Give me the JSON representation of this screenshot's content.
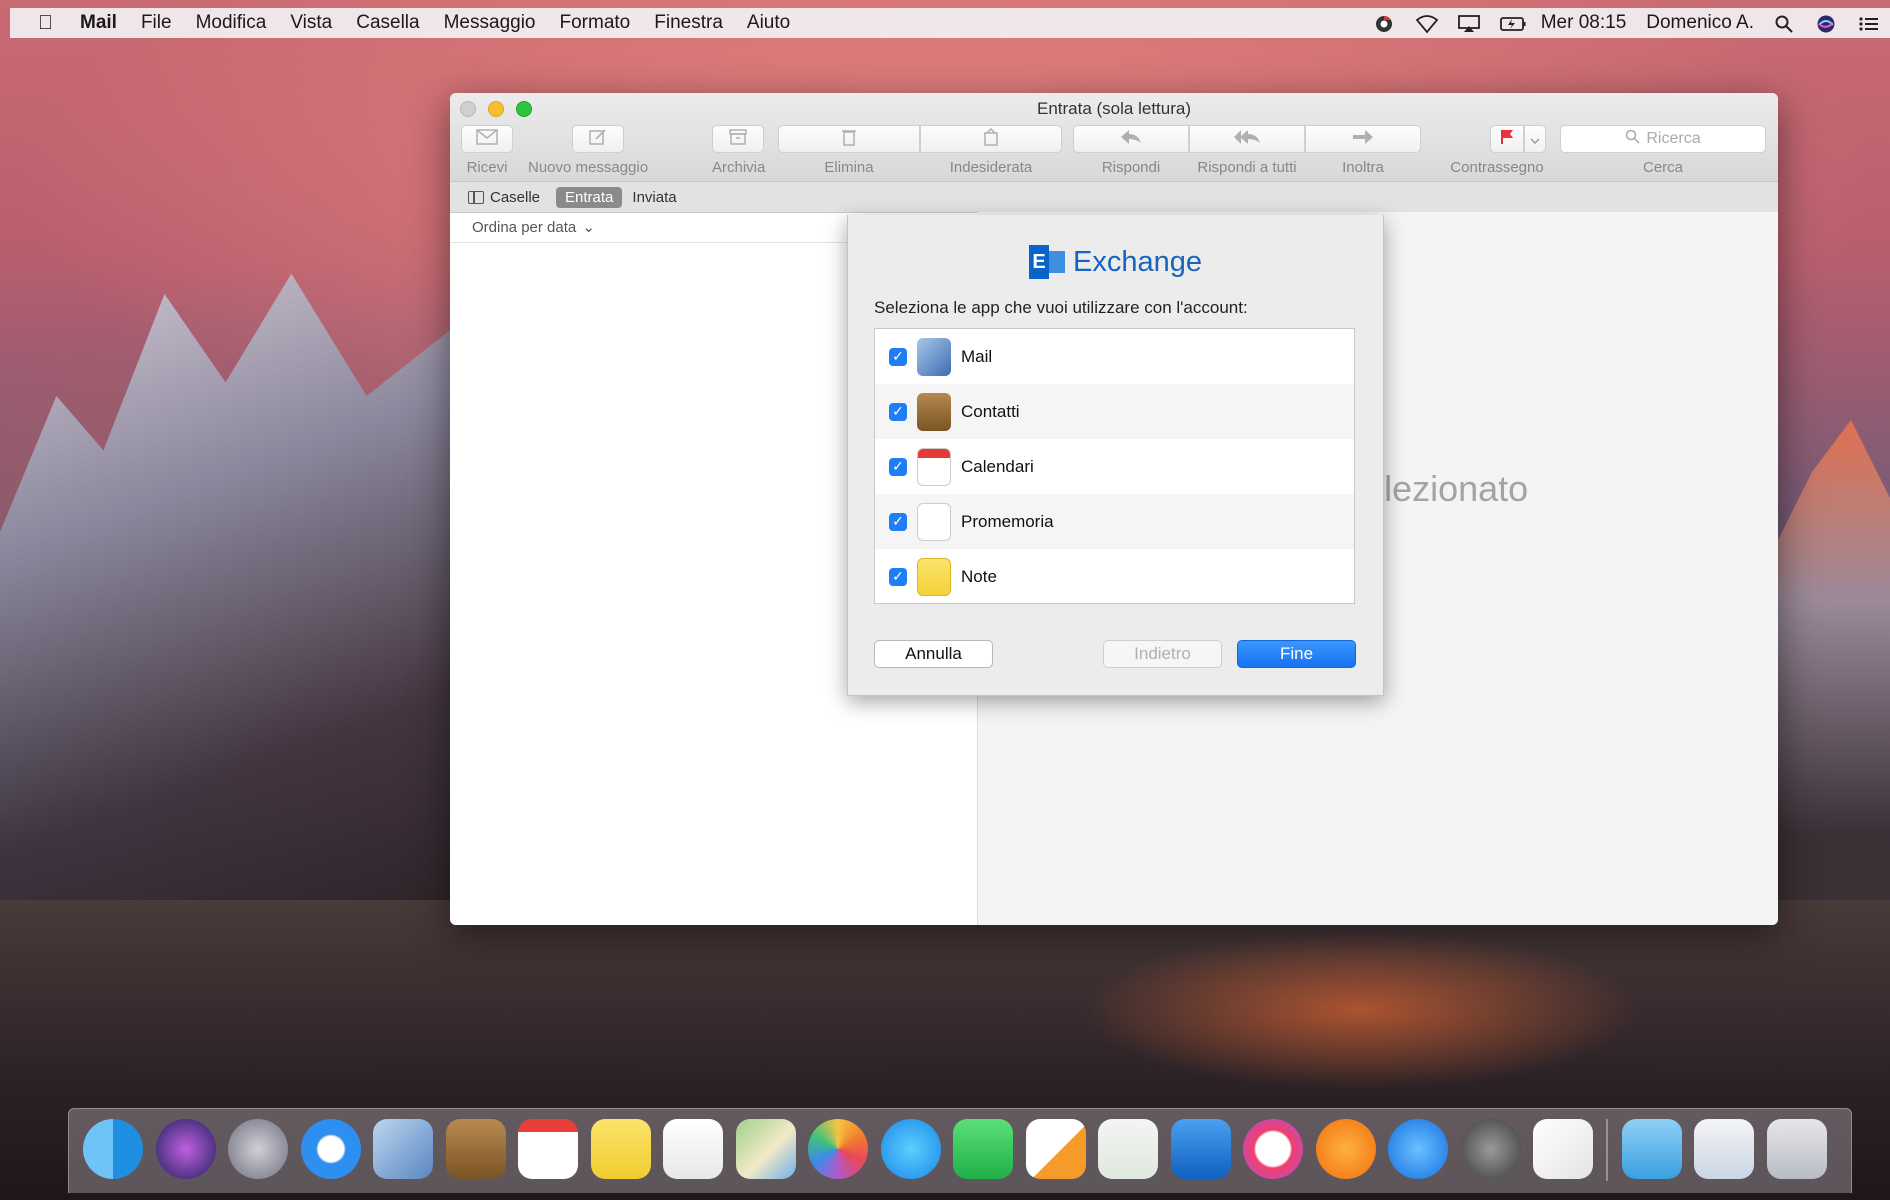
{
  "menubar": {
    "items": [
      "Mail",
      "File",
      "Modifica",
      "Vista",
      "Casella",
      "Messaggio",
      "Formato",
      "Finestra",
      "Aiuto"
    ],
    "clock": "Mer 08:15",
    "user": "Domenico A."
  },
  "window": {
    "title": "Entrata (sola lettura)",
    "toolbar": {
      "get_mail": "Ricevi",
      "new_message": "Nuovo messaggio",
      "archive": "Archivia",
      "delete": "Elimina",
      "junk": "Indesiderata",
      "reply": "Rispondi",
      "reply_all": "Rispondi a tutti",
      "forward": "Inoltra",
      "flag": "Contrassegno",
      "search_placeholder": "Ricerca",
      "search_label": "Cerca"
    },
    "favorites": {
      "mailboxes": "Caselle",
      "inbox": "Entrata",
      "sent": "Inviata"
    },
    "sort_label": "Ordina per data",
    "no_message_fragment": "gio selezionato"
  },
  "sheet": {
    "brand": "Exchange",
    "logo_letter": "E",
    "prompt": "Seleziona le app che vuoi utilizzare con l'account:",
    "apps": [
      {
        "name": "Mail",
        "checked": true
      },
      {
        "name": "Contatti",
        "checked": true
      },
      {
        "name": "Calendari",
        "checked": true
      },
      {
        "name": "Promemoria",
        "checked": true
      },
      {
        "name": "Note",
        "checked": true
      }
    ],
    "buttons": {
      "cancel": "Annulla",
      "back": "Indietro",
      "done": "Fine"
    }
  },
  "dock": {
    "icons": [
      "finder-icon",
      "siri-icon",
      "launchpad-icon",
      "safari-icon",
      "mail-icon",
      "contacts-icon",
      "calendar-icon",
      "notes-icon",
      "reminders-icon",
      "maps-icon",
      "photos-icon",
      "messages-icon",
      "facetime-icon",
      "pages-icon",
      "numbers-icon",
      "keynote-icon",
      "itunes-icon",
      "ibooks-icon",
      "app-store-icon",
      "system-preferences-icon",
      "textedit-icon",
      "downloads-folder-icon",
      "preview-icon",
      "trash-icon"
    ]
  },
  "colors": {
    "accent": "#1f7ef6",
    "exchange_blue": "#1565c0"
  }
}
